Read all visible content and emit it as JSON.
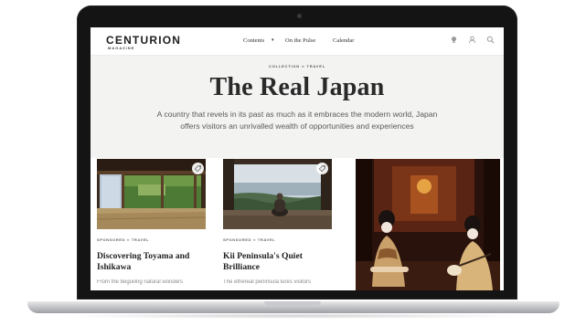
{
  "header": {
    "logo": "CENTURION",
    "logo_sub": "MAGAZINE",
    "nav": [
      "Contents",
      "On the Pulse",
      "Calendar"
    ],
    "icons": [
      "lightbulb-icon",
      "user-icon",
      "search-icon"
    ]
  },
  "hero": {
    "breadcrumb": "COLLECTION ∞ TRAVEL",
    "title": "The Real Japan",
    "description": "A country that revels in its past as much as it embraces the modern world, Japan offers visitors an unrivalled wealth of opportunities and experiences"
  },
  "cards": [
    {
      "tag": "SPONSORED ∞ TRAVEL",
      "title": "Discovering Toyama and Ishikawa",
      "excerpt": "From the beguiling natural wonders"
    },
    {
      "tag": "SPONSORED ∞ TRAVEL",
      "title": "Kii Peninsula's Quiet Brilliance",
      "excerpt": "The ethereal peninsula lures visitors"
    }
  ],
  "colors": {
    "hero_bg": "#f3f3f2",
    "text_dark": "#2a2a2a",
    "bezel": "#141414"
  }
}
